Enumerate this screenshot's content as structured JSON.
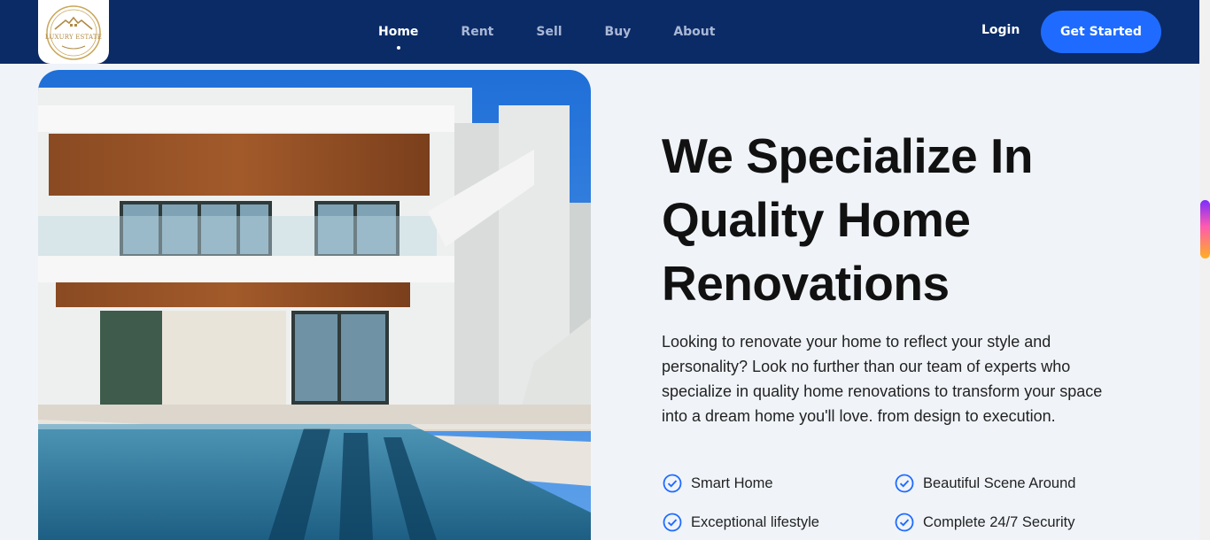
{
  "brand": {
    "logo_text": "LUXURY ESTATE"
  },
  "nav": {
    "items": [
      {
        "label": "Home"
      },
      {
        "label": "Rent"
      },
      {
        "label": "Sell"
      },
      {
        "label": "Buy"
      },
      {
        "label": "About"
      }
    ],
    "active": "Home",
    "login_label": "Login",
    "cta_label": "Get Started"
  },
  "hero": {
    "headline_lines": [
      "We Specialize In",
      "Quality Home",
      "Renovations"
    ],
    "description": "Looking to renovate your home to reflect your style and personality? Look no further than our team of experts who specialize in quality home renovations to transform your space into a dream home you'll love. from design to execution.",
    "features": [
      {
        "label": "Smart Home",
        "icon": "check-circle-icon"
      },
      {
        "label": "Beautiful Scene Around",
        "icon": "check-circle-icon"
      },
      {
        "label": "Exceptional lifestyle",
        "icon": "check-circle-icon"
      },
      {
        "label": "Complete 24/7 Security",
        "icon": "check-circle-icon"
      }
    ]
  },
  "colors": {
    "nav_bg": "#0b2b66",
    "accent": "#1f6bff",
    "page_bg": "#f0f4f9",
    "check_color": "#1f6bff"
  }
}
